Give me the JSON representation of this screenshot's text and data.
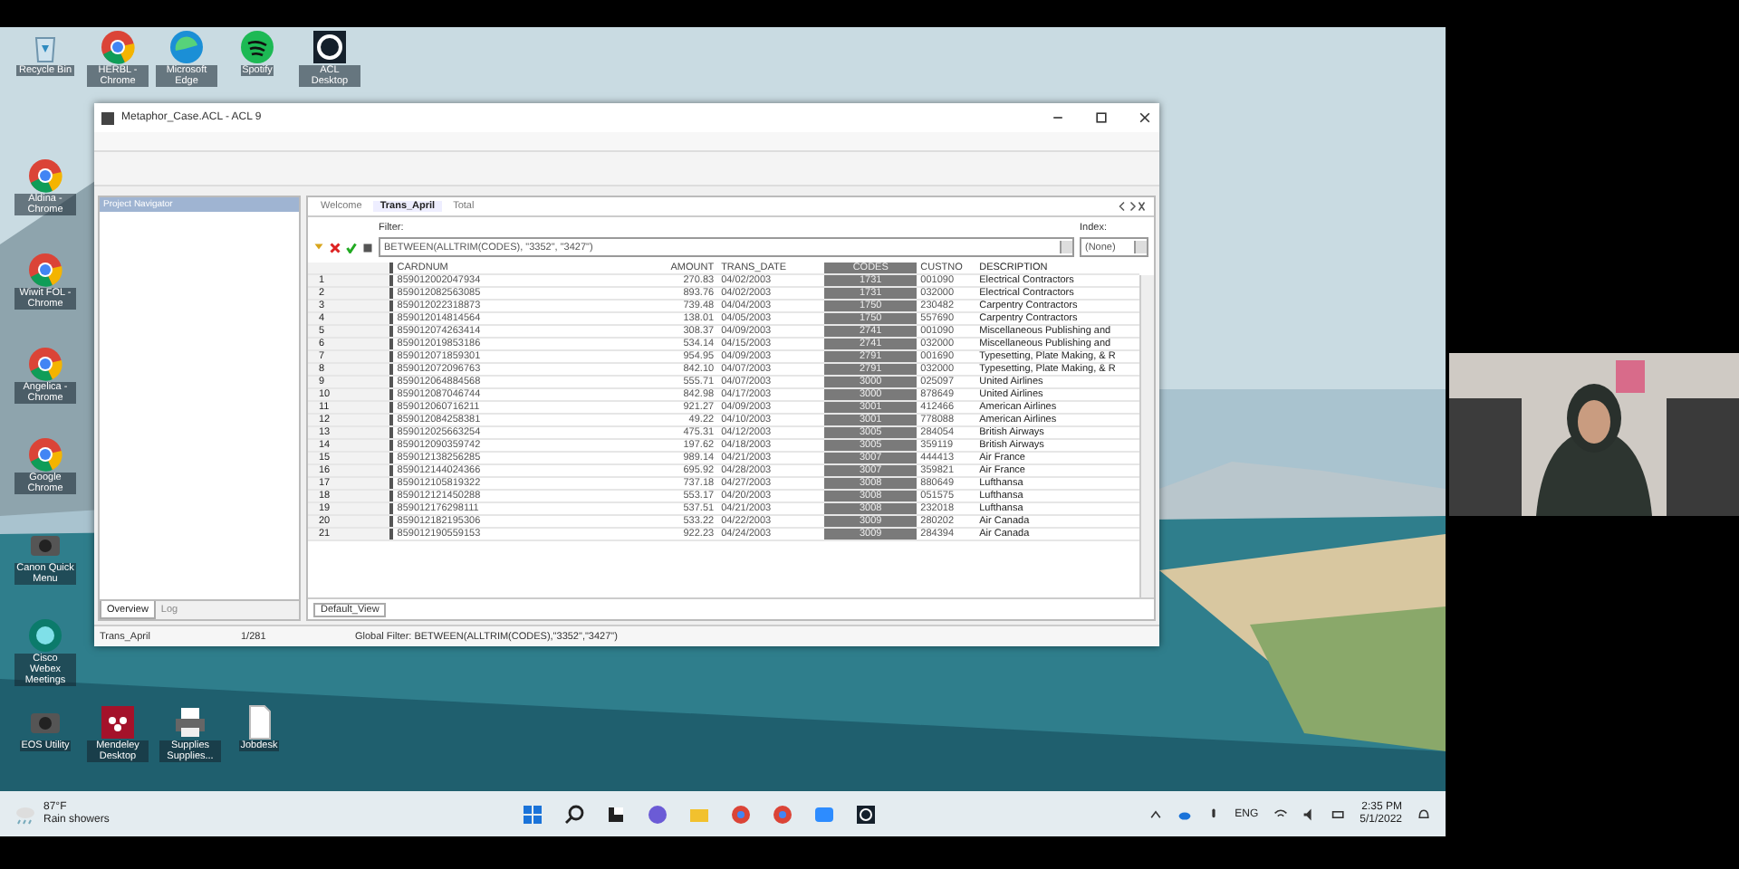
{
  "desktop_icons": [
    {
      "label": "Recycle Bin",
      "kind": "recycle"
    },
    {
      "label": "HERBL - Chrome",
      "kind": "chrome"
    },
    {
      "label": "Microsoft Edge",
      "kind": "edge"
    },
    {
      "label": "Spotify",
      "kind": "spotify"
    },
    {
      "label": "ACL Desktop",
      "kind": "acl"
    },
    {
      "label": "Aldina - Chrome",
      "kind": "chrome"
    },
    {
      "label": "Wiwit FOL - Chrome",
      "kind": "chrome"
    },
    {
      "label": "Angelica - Chrome",
      "kind": "chrome"
    },
    {
      "label": "Google Chrome",
      "kind": "chrome"
    },
    {
      "label": "Canon Quick Menu",
      "kind": "camera"
    },
    {
      "label": "Cisco Webex Meetings",
      "kind": "webex"
    },
    {
      "label": "EOS Utility",
      "kind": "camera"
    },
    {
      "label": "Mendeley Desktop",
      "kind": "mendeley"
    },
    {
      "label": "Supplies Supplies...",
      "kind": "printer"
    },
    {
      "label": "Jobdesk",
      "kind": "file"
    }
  ],
  "window": {
    "title": "Metaphor_Case.ACL - ACL 9",
    "navigator": {
      "title": "Project Navigator",
      "tabs": [
        {
          "label": "Overview",
          "selected": true
        },
        {
          "label": "Log",
          "selected": false
        }
      ]
    },
    "tabs": [
      {
        "label": "Welcome",
        "selected": false
      },
      {
        "label": "Trans_April",
        "selected": true
      },
      {
        "label": "Total",
        "selected": false
      }
    ],
    "filter": {
      "label": "Filter:",
      "value": "BETWEEN(ALLTRIM(CODES), \"3352\", \"3427\")"
    },
    "index": {
      "label": "Index:",
      "value": "(None)"
    },
    "table": {
      "columns": [
        "CARDNUM",
        "AMOUNT",
        "TRANS_DATE",
        "CODES",
        "CUSTNO",
        "DESCRIPTION"
      ],
      "rows": [
        {
          "number": "1",
          "cells": [
            "859012002047934",
            "270.83",
            "04/02/2003",
            "1731",
            "001090",
            "Electrical Contractors"
          ]
        },
        {
          "number": "2",
          "cells": [
            "859012082563085",
            "893.76",
            "04/02/2003",
            "1731",
            "032000",
            "Electrical Contractors"
          ]
        },
        {
          "number": "3",
          "cells": [
            "859012022318873",
            "739.48",
            "04/04/2003",
            "1750",
            "230482",
            "Carpentry Contractors"
          ]
        },
        {
          "number": "4",
          "cells": [
            "859012014814564",
            "138.01",
            "04/05/2003",
            "1750",
            "557690",
            "Carpentry Contractors"
          ]
        },
        {
          "number": "5",
          "cells": [
            "859012074263414",
            "308.37",
            "04/09/2003",
            "2741",
            "001090",
            "Miscellaneous Publishing and"
          ]
        },
        {
          "number": "6",
          "cells": [
            "859012019853186",
            "534.14",
            "04/15/2003",
            "2741",
            "032000",
            "Miscellaneous Publishing and"
          ]
        },
        {
          "number": "7",
          "cells": [
            "859012071859301",
            "954.95",
            "04/09/2003",
            "2791",
            "001690",
            "Typesetting, Plate Making, & R"
          ]
        },
        {
          "number": "8",
          "cells": [
            "859012072096763",
            "842.10",
            "04/07/2003",
            "2791",
            "032000",
            "Typesetting, Plate Making, & R"
          ]
        },
        {
          "number": "9",
          "cells": [
            "859012064884568",
            "555.71",
            "04/07/2003",
            "3000",
            "025097",
            "United Airlines"
          ]
        },
        {
          "number": "10",
          "cells": [
            "859012087046744",
            "842.98",
            "04/17/2003",
            "3000",
            "878649",
            "United Airlines"
          ]
        },
        {
          "number": "11",
          "cells": [
            "859012060716211",
            "921.27",
            "04/09/2003",
            "3001",
            "412466",
            "American Airlines"
          ]
        },
        {
          "number": "12",
          "cells": [
            "859012084258381",
            "49.22",
            "04/10/2003",
            "3001",
            "778088",
            "American Airlines"
          ]
        },
        {
          "number": "13",
          "cells": [
            "859012025663254",
            "475.31",
            "04/12/2003",
            "3005",
            "284054",
            "British Airways"
          ]
        },
        {
          "number": "14",
          "cells": [
            "859012090359742",
            "197.62",
            "04/18/2003",
            "3005",
            "359119",
            "British Airways"
          ]
        },
        {
          "number": "15",
          "cells": [
            "859012138256285",
            "989.14",
            "04/21/2003",
            "3007",
            "444413",
            "Air France"
          ]
        },
        {
          "number": "16",
          "cells": [
            "859012144024366",
            "695.92",
            "04/28/2003",
            "3007",
            "359821",
            "Air France"
          ]
        },
        {
          "number": "17",
          "cells": [
            "859012105819322",
            "737.18",
            "04/27/2003",
            "3008",
            "880649",
            "Lufthansa"
          ]
        },
        {
          "number": "18",
          "cells": [
            "859012121450288",
            "553.17",
            "04/20/2003",
            "3008",
            "051575",
            "Lufthansa"
          ]
        },
        {
          "number": "19",
          "cells": [
            "859012176298111",
            "537.51",
            "04/21/2003",
            "3008",
            "232018",
            "Lufthansa"
          ]
        },
        {
          "number": "20",
          "cells": [
            "859012182195306",
            "533.22",
            "04/22/2003",
            "3009",
            "280202",
            "Air Canada"
          ]
        },
        {
          "number": "21",
          "cells": [
            "859012190559153",
            "922.23",
            "04/24/2003",
            "3009",
            "284394",
            "Air Canada"
          ]
        }
      ]
    },
    "view_tab": "Default_View",
    "status_bar": [
      "Trans_April",
      "1/281",
      "Global Filter: BETWEEN(ALLTRIM(CODES),\"3352\",\"3427\")"
    ]
  },
  "taskbar": {
    "temperature": "87°F",
    "weather": "Rain showers",
    "language": "ENG",
    "time": "2:35 PM",
    "date": "5/1/2022"
  }
}
